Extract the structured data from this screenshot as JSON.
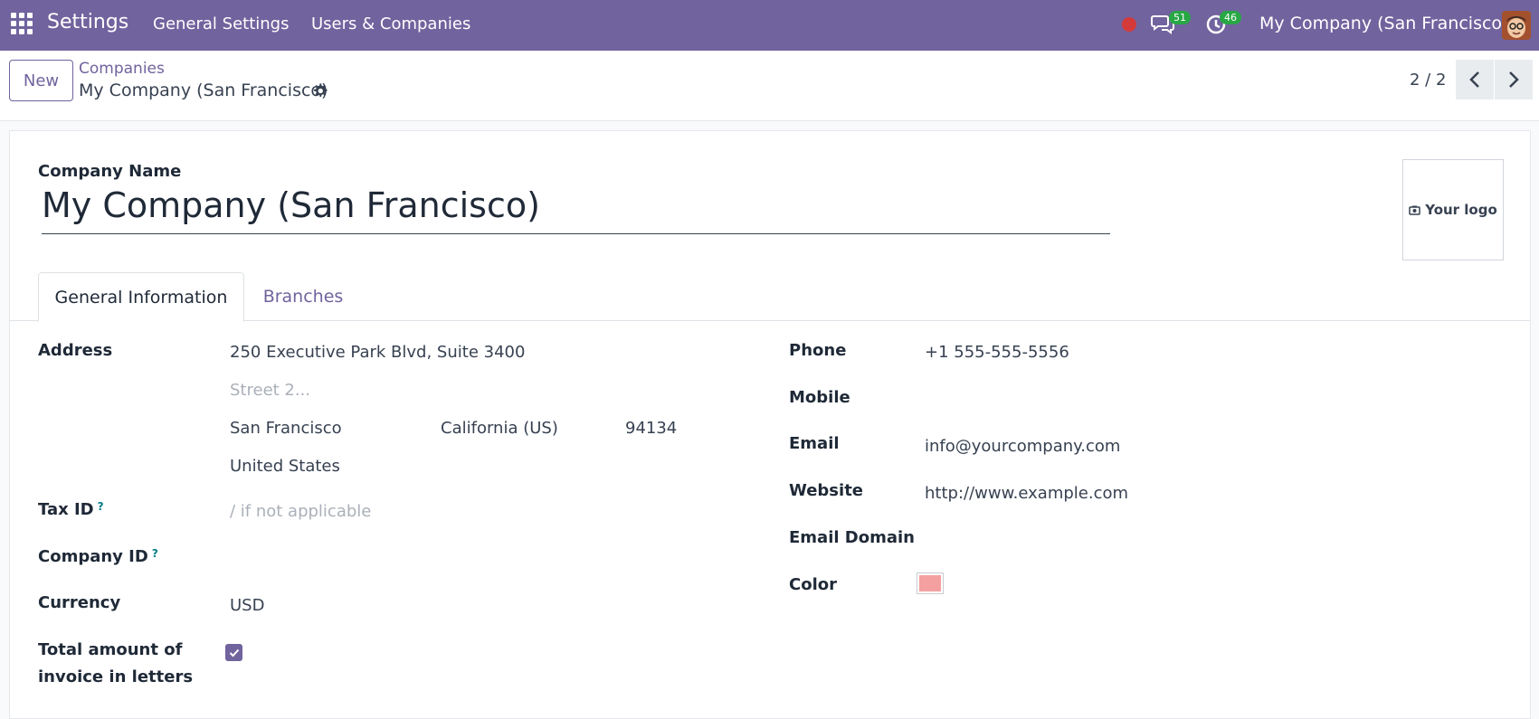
{
  "navbar": {
    "app_title": "Settings",
    "menu": [
      "General Settings",
      "Users & Companies"
    ],
    "messages_count": "51",
    "activities_count": "46",
    "company_switcher": "My Company (San Francisco)",
    "colors": {
      "navbar_bg": "#71639e",
      "badge": "#28a745",
      "recording": "#d43a3a"
    }
  },
  "control_panel": {
    "new_button": "New",
    "breadcrumb_parent": "Companies",
    "breadcrumb_current": "My Company (San Francisco)",
    "pager": "2 / 2"
  },
  "form": {
    "company_name_label": "Company Name",
    "company_name": "My Company (San Francisco)",
    "logo_label": "Your logo",
    "tabs": [
      "General Information",
      "Branches"
    ],
    "left": {
      "address_label": "Address",
      "street": "250 Executive Park Blvd, Suite 3400",
      "street2_placeholder": "Street 2...",
      "city": "San Francisco",
      "state": "California (US)",
      "zip": "94134",
      "country": "United States",
      "tax_id_label": "Tax ID",
      "tax_id_placeholder": "/ if not applicable",
      "company_id_label": "Company ID",
      "currency_label": "Currency",
      "currency": "USD",
      "invoice_letters_label_1": "Total amount of",
      "invoice_letters_label_2": "invoice in letters",
      "invoice_letters_checked": true,
      "help_mark": "?"
    },
    "right": {
      "phone_label": "Phone",
      "phone": "+1 555-555-5556",
      "mobile_label": "Mobile",
      "email_label": "Email",
      "email": "info@yourcompany.com",
      "website_label": "Website",
      "website": "http://www.example.com",
      "email_domain_label": "Email Domain",
      "color_label": "Color",
      "color_value": "#f4a0a0"
    }
  }
}
